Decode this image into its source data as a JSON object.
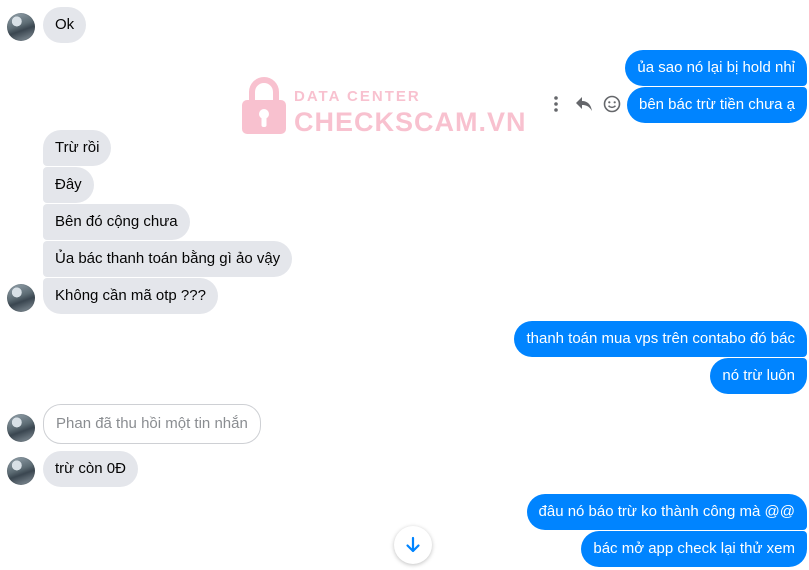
{
  "conversation": {
    "messages": [
      {
        "id": "m1",
        "text": "Ok"
      },
      {
        "id": "m2",
        "text": "ủa sao nó lại bị hold nhỉ"
      },
      {
        "id": "m3",
        "text": "bên bác trừ tiền chưa ạ"
      },
      {
        "id": "m4",
        "text": "Trừ rồi"
      },
      {
        "id": "m5",
        "text": "Đây"
      },
      {
        "id": "m6",
        "text": "Bên đó cộng chưa"
      },
      {
        "id": "m7",
        "text": "Ủa bác thanh toán bằng gì ảo vậy"
      },
      {
        "id": "m8",
        "text": "Không cần mã otp ???"
      },
      {
        "id": "m9",
        "text": "thanh toán mua vps trên contabo đó bác"
      },
      {
        "id": "m10",
        "text": "nó trừ luôn"
      },
      {
        "id": "m11",
        "text": "Phan đã thu hồi một tin nhắn"
      },
      {
        "id": "m12",
        "text": "trừ còn 0Đ"
      },
      {
        "id": "m13",
        "text": "đâu nó báo trừ ko thành công mà @@"
      },
      {
        "id": "m14",
        "text": "bác mở app check lại thử xem"
      }
    ]
  },
  "watermark": {
    "line1": "DATA CENTER",
    "line2": "CHECKSCAM.VN"
  },
  "icons": {
    "more": "more-vertical-icon",
    "reply": "reply-icon",
    "react": "smiley-icon",
    "scroll": "arrow-down-icon"
  },
  "colors": {
    "outgoing": "#0084ff",
    "incoming": "#e4e6eb",
    "watermark": "#f48fa8"
  }
}
